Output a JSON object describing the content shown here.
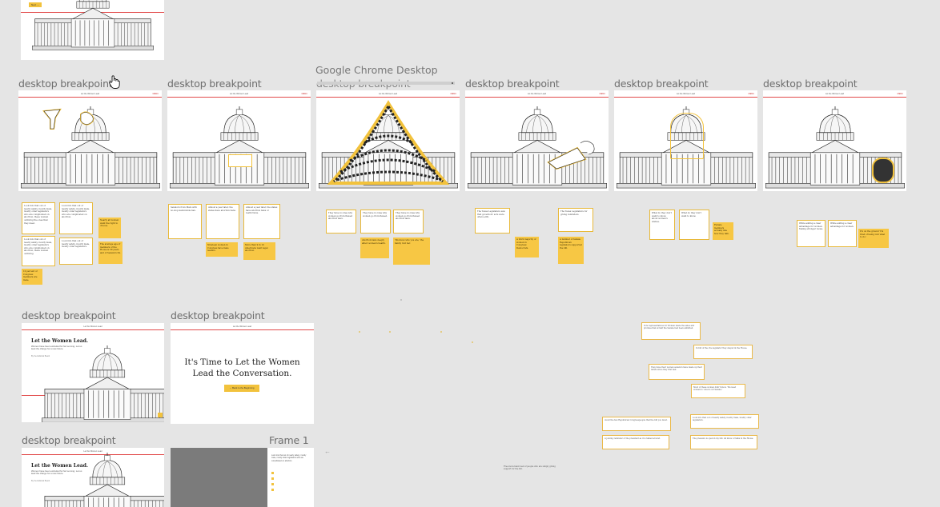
{
  "canvas": {
    "background": "#e5e5e5",
    "accent_red": "#e24b4b",
    "accent_yellow": "#f7c744"
  },
  "labels": {
    "row1": [
      "desktop breakpoint",
      "desktop breakpoint",
      "desktop breakpoint",
      "desktop breakpoint",
      "desktop breakpoint",
      "desktop breakpoint"
    ],
    "row2": [
      "desktop breakpoint",
      "desktop breakpoint"
    ],
    "row3": [
      "desktop breakpoint",
      "Frame 1"
    ]
  },
  "tooltip": {
    "title": "Google Chrome Desktop",
    "subtitle": "desktop breakpoint"
  },
  "top_frame": {
    "tag": "Next →"
  },
  "frame_header": "Let the Women Lead",
  "frame_menu": "MENU",
  "lead_frame": {
    "title": "Let the Women Lead.",
    "subtitle": "Women have been excluded for far too long. Let us lead the charge for a new future.",
    "byline": "By the Editorial Board"
  },
  "cta_frame": {
    "headline_1": "It's Time to Let the Women",
    "headline_2": "Lead the Conversation.",
    "button": "← Back to the Beginning"
  },
  "notes": {
    "n1": "Look into that out of nearly safety, mostly male, mostly older legislators who are complicated on abortion, these women outliving the ones that they meet.",
    "n2": "Look into that out of nearly safety, mostly male, mostly older legislators who are complicated on abortion.",
    "n3": "Look into that out of nearly safety, mostly male, mostly older legislators who are complicated on abortion, these women outliving.",
    "n4": "Look into that out of nearly safety, mostly male, mostly older legislators.",
    "y1": "Nearly all women want the right to choose.",
    "y2": "The average age of members of the House is 58 years and of Senators 64.",
    "y3": "10 percent of Congress members are male.",
    "s1": "Senators from Mars with no-stop-nationwide ban.",
    "s2": "Almost a year later, the states have abortion bans.",
    "s3": "Almost a year later, the states have abortion bans or restrictions.",
    "sy1": "Nineteen women in Congress have male leaders.",
    "sy2": "More than 9 in 10 Americans want legal abortion.",
    "w1": "They have no idea why women go from flawed abortion laws.",
    "w2": "They have no idea why women go from flawed.",
    "w3": "They have no idea why women go from flawed abortion laws.",
    "wy1": "Abortion bans deeply affect women's health.",
    "wy2": "'We know who you are,' the family told her.",
    "f1": "The Texas Legislature saw that governors' acts were often a-OK.",
    "f2": "The Texas Legislature for giving reminders.",
    "fy1": "A 2022 majority of women in Congress: Democrats.",
    "fy2": "A number of female Republican legislators supported the bill.",
    "g1": "What do they don't want to know about women's wishes.",
    "g2": "What do they don't want to know.",
    "gy1": "Female members actually like how they talk.",
    "h1": "While adding a clear advantage for women. Taking stronger views.",
    "h2": "While adding a clear advantage for women.",
    "hy1": "It's on the ground 'I'm tired of being told what to do.'"
  },
  "loose": {
    "l1": "Vote representatives for Women made the sales and promise that at half the Senate had been admitted.",
    "l2": "In full of the, the legislator they stayed in the House.",
    "l3": "They have their women senators have made up their minds since they first met.",
    "l4": "Most of these women didn't know. 'We need women to vote in our Senate.'",
    "l5": "Avoid the few Republican Congresspeople that the bill you must.",
    "l6": "Look into that out of nearly safety, mostly male, mostly older legislators.",
    "l7": "A joining reminder of the president as it is talked around.",
    "l8": "The pressure is open in my bill. All know of talks in the House.",
    "l9": "Free more hand load of people who are simply giving support for the bill.",
    "aside": "Look into that out of nearly safety, mostly male, mostly older legislators who are complicated on abortion."
  }
}
